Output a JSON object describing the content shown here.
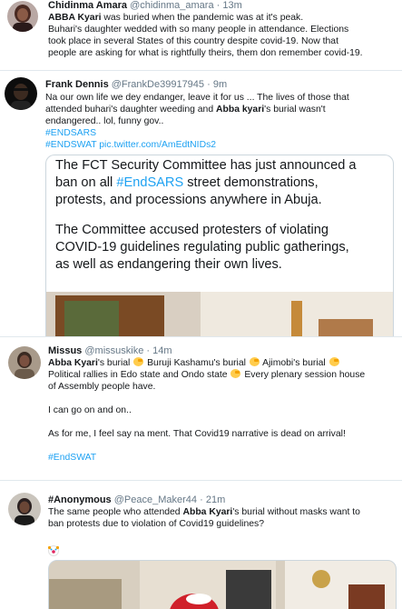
{
  "tweets": [
    {
      "name": "Chidinma Amara",
      "handle": "@chidinma_amara",
      "time": "13m",
      "lines": [
        {
          "pre": "",
          "bold": "ABBA Kyari",
          "post": " was buried when the pandemic was at it's peak."
        },
        {
          "text": "Buhari's daughter wedded with so many people in attendance. Elections"
        },
        {
          "text": "took place in several States of this country despite covid-19. Now that"
        },
        {
          "text": "people are asking for what is rightfully theirs, them don remember covid-19."
        }
      ]
    },
    {
      "name": "Frank Dennis",
      "handle": "@FrankDe39917945",
      "time": "9m",
      "lines": [
        {
          "text": "Na our own life we dey endanger, leave it for us ... The lives of those that"
        },
        {
          "pre": "attended buhari's daughter weeding and ",
          "bold": "Abba kyari",
          "post": "'s burial wasn't"
        },
        {
          "text": "endangered.. lol, funny gov.."
        }
      ],
      "hashtags": [
        "#ENDSARS",
        "#ENDSWAT"
      ],
      "pic_link": "pic.twitter.com/AmEdtNIDs2",
      "image_text": {
        "line1_pre": "The FCT Security Committee has just announced a",
        "line2_pre": "ban on all ",
        "line2_tag": "#EndSARS",
        "line2_post": " street demonstrations,",
        "line3": "protests, and processions anywhere in Abuja.",
        "line4": "The Committee accused protesters of violating",
        "line5": "COVID-19 guidelines regulating public gatherings,",
        "line6": "as well as endangering their own lives."
      },
      "hashtag_color": "#1da1f2"
    },
    {
      "name": "Missus",
      "handle": "@missuskike",
      "time": "14m",
      "line1_parts": [
        "Abba Kyari",
        "'s burial",
        "Buruji Kashamu's burial",
        "Ajimobi's burial"
      ],
      "line2": "Political rallies in Edo state and Ondo state",
      "line2_post": "Every plenary session house",
      "line3": "of Assembly people have.",
      "line4": "I can go on and on..",
      "line5": "As for me, I feel say na ment. That Covid19 narrative is dead on arrival!",
      "hashtag": "#EndSWAT"
    },
    {
      "name": "#Anonymous",
      "handle": "@Peace_Maker44",
      "time": "21m",
      "line1_pre": "The same people who attended ",
      "line1_bold": "Abba Kyari",
      "line1_post": "'s burial without masks want to",
      "line2": "ban protests due to violation of Covid19 guidelines?"
    }
  ],
  "separator": "·",
  "colors": {
    "link": "#1da1f2",
    "muted": "#657786",
    "border": "#e1e8ed"
  }
}
